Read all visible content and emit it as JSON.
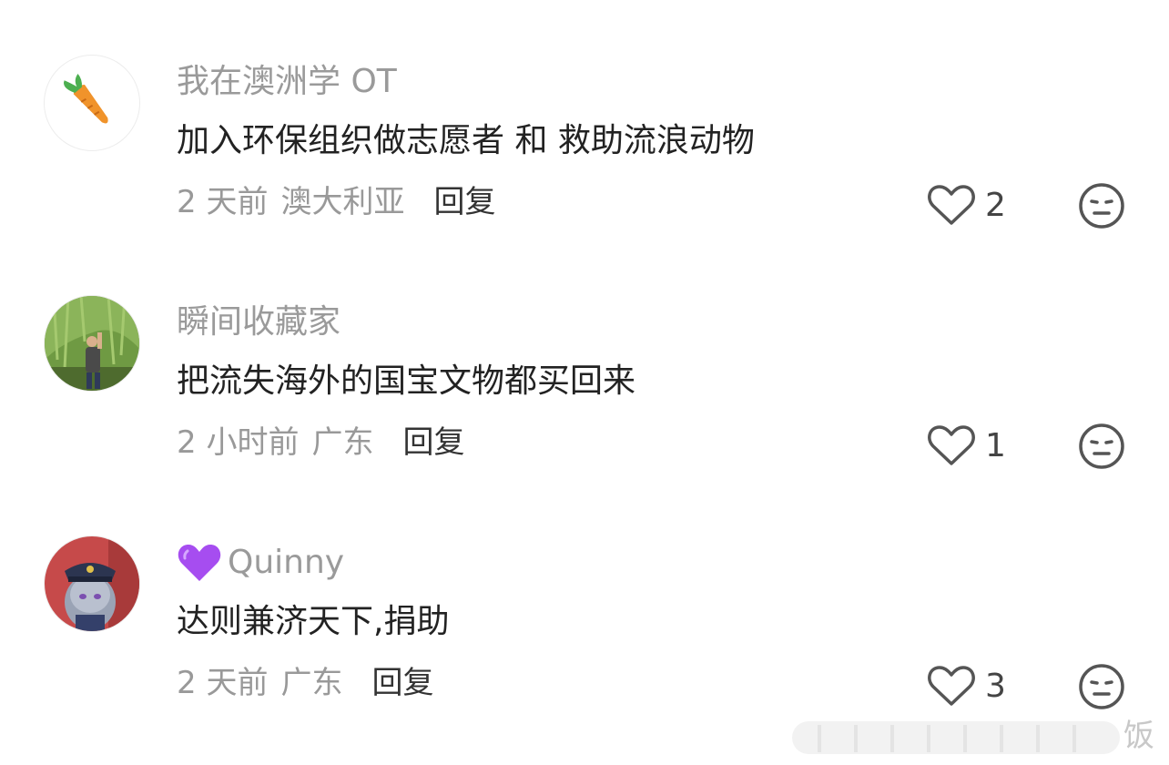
{
  "comments": [
    {
      "username": "我在澳洲学 OT",
      "text": "加入环保组织做志愿者 和 救助流浪动物",
      "time": "2 天前",
      "location": "澳大利亚",
      "reply_label": "回复",
      "likes": "2",
      "avatar": "carrot-avatar"
    },
    {
      "username": "瞬间收藏家",
      "text": "把流失海外的国宝文物都买回来",
      "time": "2 小时前",
      "location": "广东",
      "reply_label": "回复",
      "likes": "1",
      "avatar": "photo-avatar"
    },
    {
      "username": "Quinny",
      "text": "达则兼济天下,捐助",
      "time": "2 天前",
      "location": "广东",
      "reply_label": "回复",
      "likes": "3",
      "avatar": "cartoon-rabbit-avatar",
      "badge": "purple-heart-icon"
    }
  ],
  "watermark": {
    "text": "饭"
  },
  "colors": {
    "username": "#9a9a9a",
    "text": "#222222",
    "meta": "#999999",
    "badge": "#a64df0"
  }
}
